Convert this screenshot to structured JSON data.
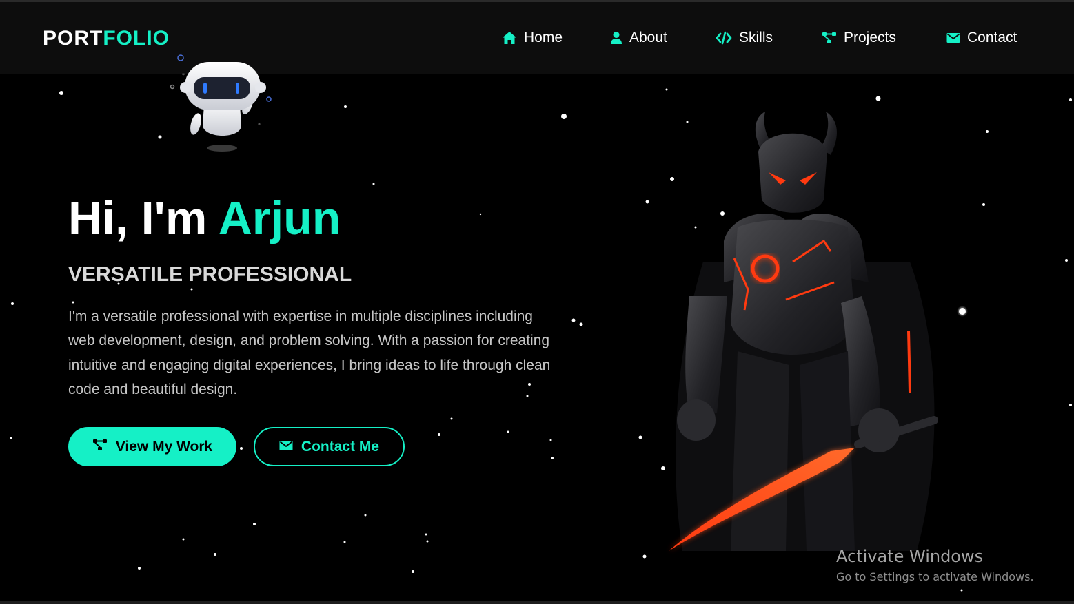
{
  "brand": {
    "part1": "PORT",
    "part2": "FOLIO"
  },
  "nav": [
    {
      "label": "Home",
      "icon": "home-icon"
    },
    {
      "label": "About",
      "icon": "user-icon"
    },
    {
      "label": "Skills",
      "icon": "code-icon"
    },
    {
      "label": "Projects",
      "icon": "project-diagram-icon"
    },
    {
      "label": "Contact",
      "icon": "envelope-icon"
    }
  ],
  "hero": {
    "greeting": "Hi, I'm ",
    "name": "Arjun",
    "subtitle": "VERSATILE PROFESSIONAL",
    "bio": "I'm a versatile professional with expertise in multiple disciplines including web development, design, and problem solving. With a passion for creating intuitive and engaging digital experiences, I bring ideas to life through clean code and beautiful design.",
    "buttons": {
      "primary": {
        "label": "View My Work",
        "icon": "project-diagram-icon"
      },
      "secondary": {
        "label": "Contact Me",
        "icon": "envelope-icon"
      }
    }
  },
  "watermark": {
    "title": "Activate Windows",
    "subtitle": "Go to Settings to activate Windows."
  },
  "colors": {
    "accent": "#15f0c6",
    "background": "#000000",
    "navbar": "#0d0d0d"
  }
}
